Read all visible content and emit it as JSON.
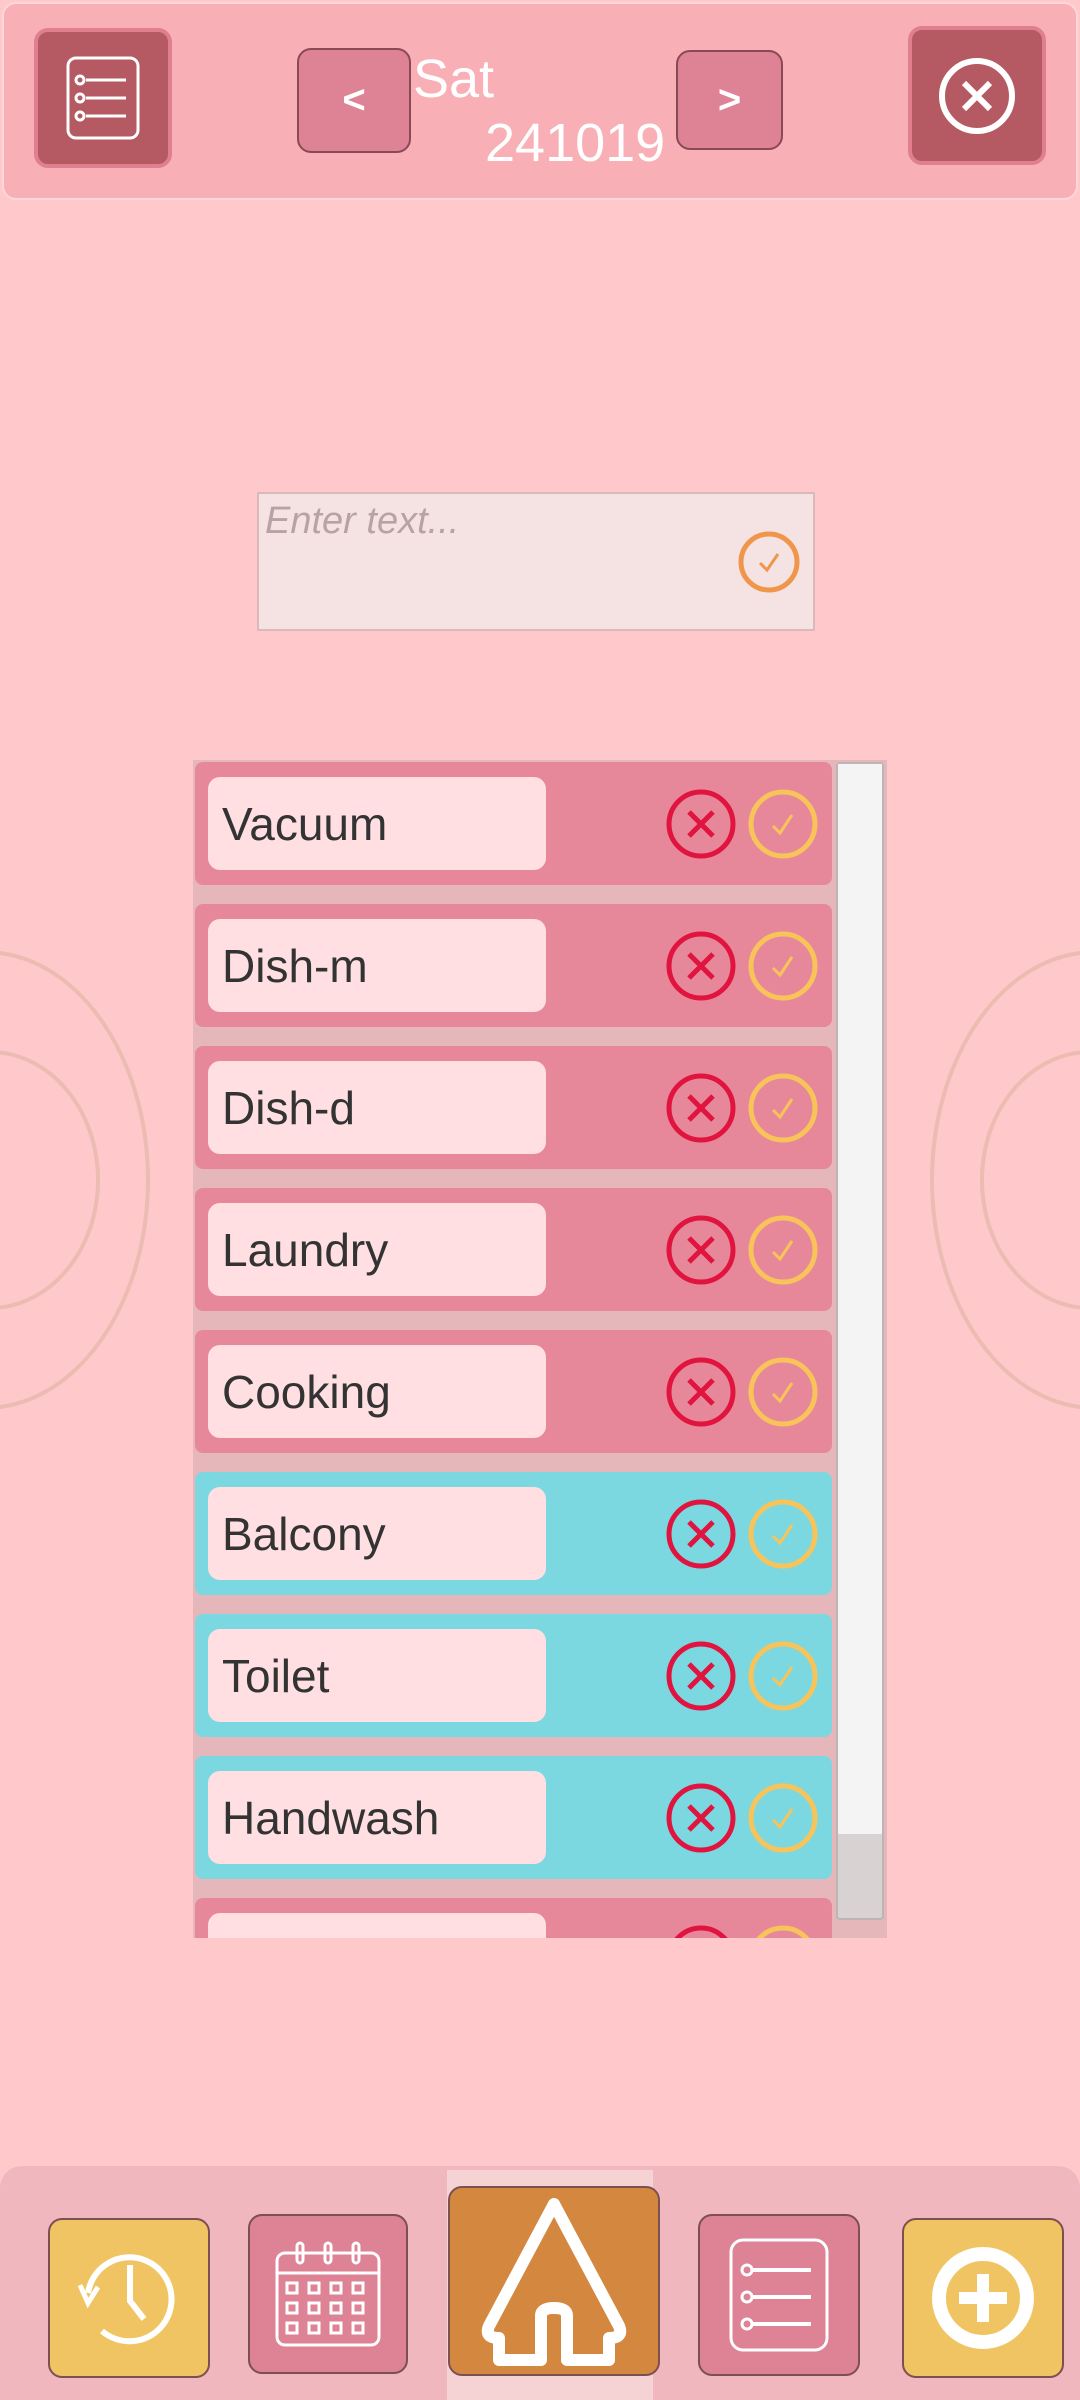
{
  "header": {
    "day": "Sat",
    "date": "241019",
    "prev_label": "<",
    "next_label": ">",
    "menu_icon": "list-icon",
    "close_icon": "close-circle-icon"
  },
  "input": {
    "placeholder": "Enter text...",
    "submit_icon": "check-circle-icon"
  },
  "tasks": [
    {
      "label": "Vacuum",
      "color": "#e7889a"
    },
    {
      "label": "Dish-m",
      "color": "#e7889a"
    },
    {
      "label": "Dish-d",
      "color": "#e7889a"
    },
    {
      "label": "Laundry",
      "color": "#e7889a"
    },
    {
      "label": "Cooking",
      "color": "#e7889a"
    },
    {
      "label": "Balcony",
      "color": "#7bd8e0"
    },
    {
      "label": "Toilet",
      "color": "#7bd8e0"
    },
    {
      "label": "Handwash",
      "color": "#7bd8e0"
    },
    {
      "label": "",
      "color": "#e7889a"
    }
  ],
  "colors": {
    "delete": "#e0143f",
    "done": "#f8c45a",
    "accent": "#d4873f"
  },
  "nav": {
    "items": [
      "history-icon",
      "calendar-icon",
      "home-icon",
      "list-icon",
      "add-icon"
    ],
    "active": "home-icon"
  }
}
